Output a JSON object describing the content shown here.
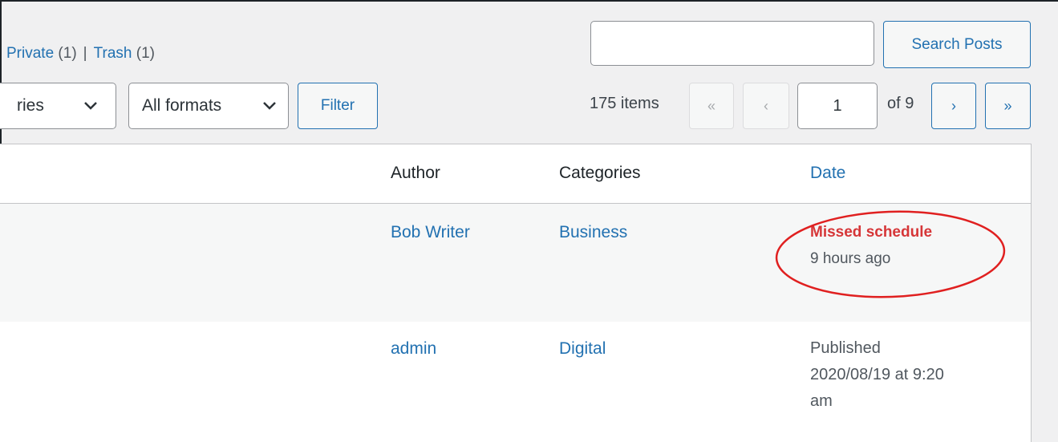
{
  "views": {
    "private_label": "Private",
    "private_count": "(1)",
    "separator": "|",
    "trash_label": "Trash",
    "trash_count": "(1)"
  },
  "search": {
    "value": "",
    "button_label": "Search Posts"
  },
  "filters": {
    "categories_selected": "ries",
    "formats_selected": "All formats",
    "filter_button": "Filter"
  },
  "pagination": {
    "items_count": "175 items",
    "first": "«",
    "prev": "‹",
    "current_page": "1",
    "of_total": "of 9",
    "next": "›",
    "last": "»"
  },
  "table": {
    "headers": {
      "author": "Author",
      "categories": "Categories",
      "date": "Date"
    },
    "rows": [
      {
        "author": "Bob Writer",
        "category": "Business",
        "status": "Missed schedule",
        "date_line": "9 hours ago"
      },
      {
        "author": "admin",
        "category": "Digital",
        "status": "Published",
        "date_line1": "2020/08/19 at 9:20",
        "date_line2": "am"
      }
    ]
  },
  "colors": {
    "link": "#2271b1",
    "missed": "#d63638",
    "annotation_circle": "#e02020"
  },
  "icons": {
    "dropdown": "chevron-down-icon"
  }
}
